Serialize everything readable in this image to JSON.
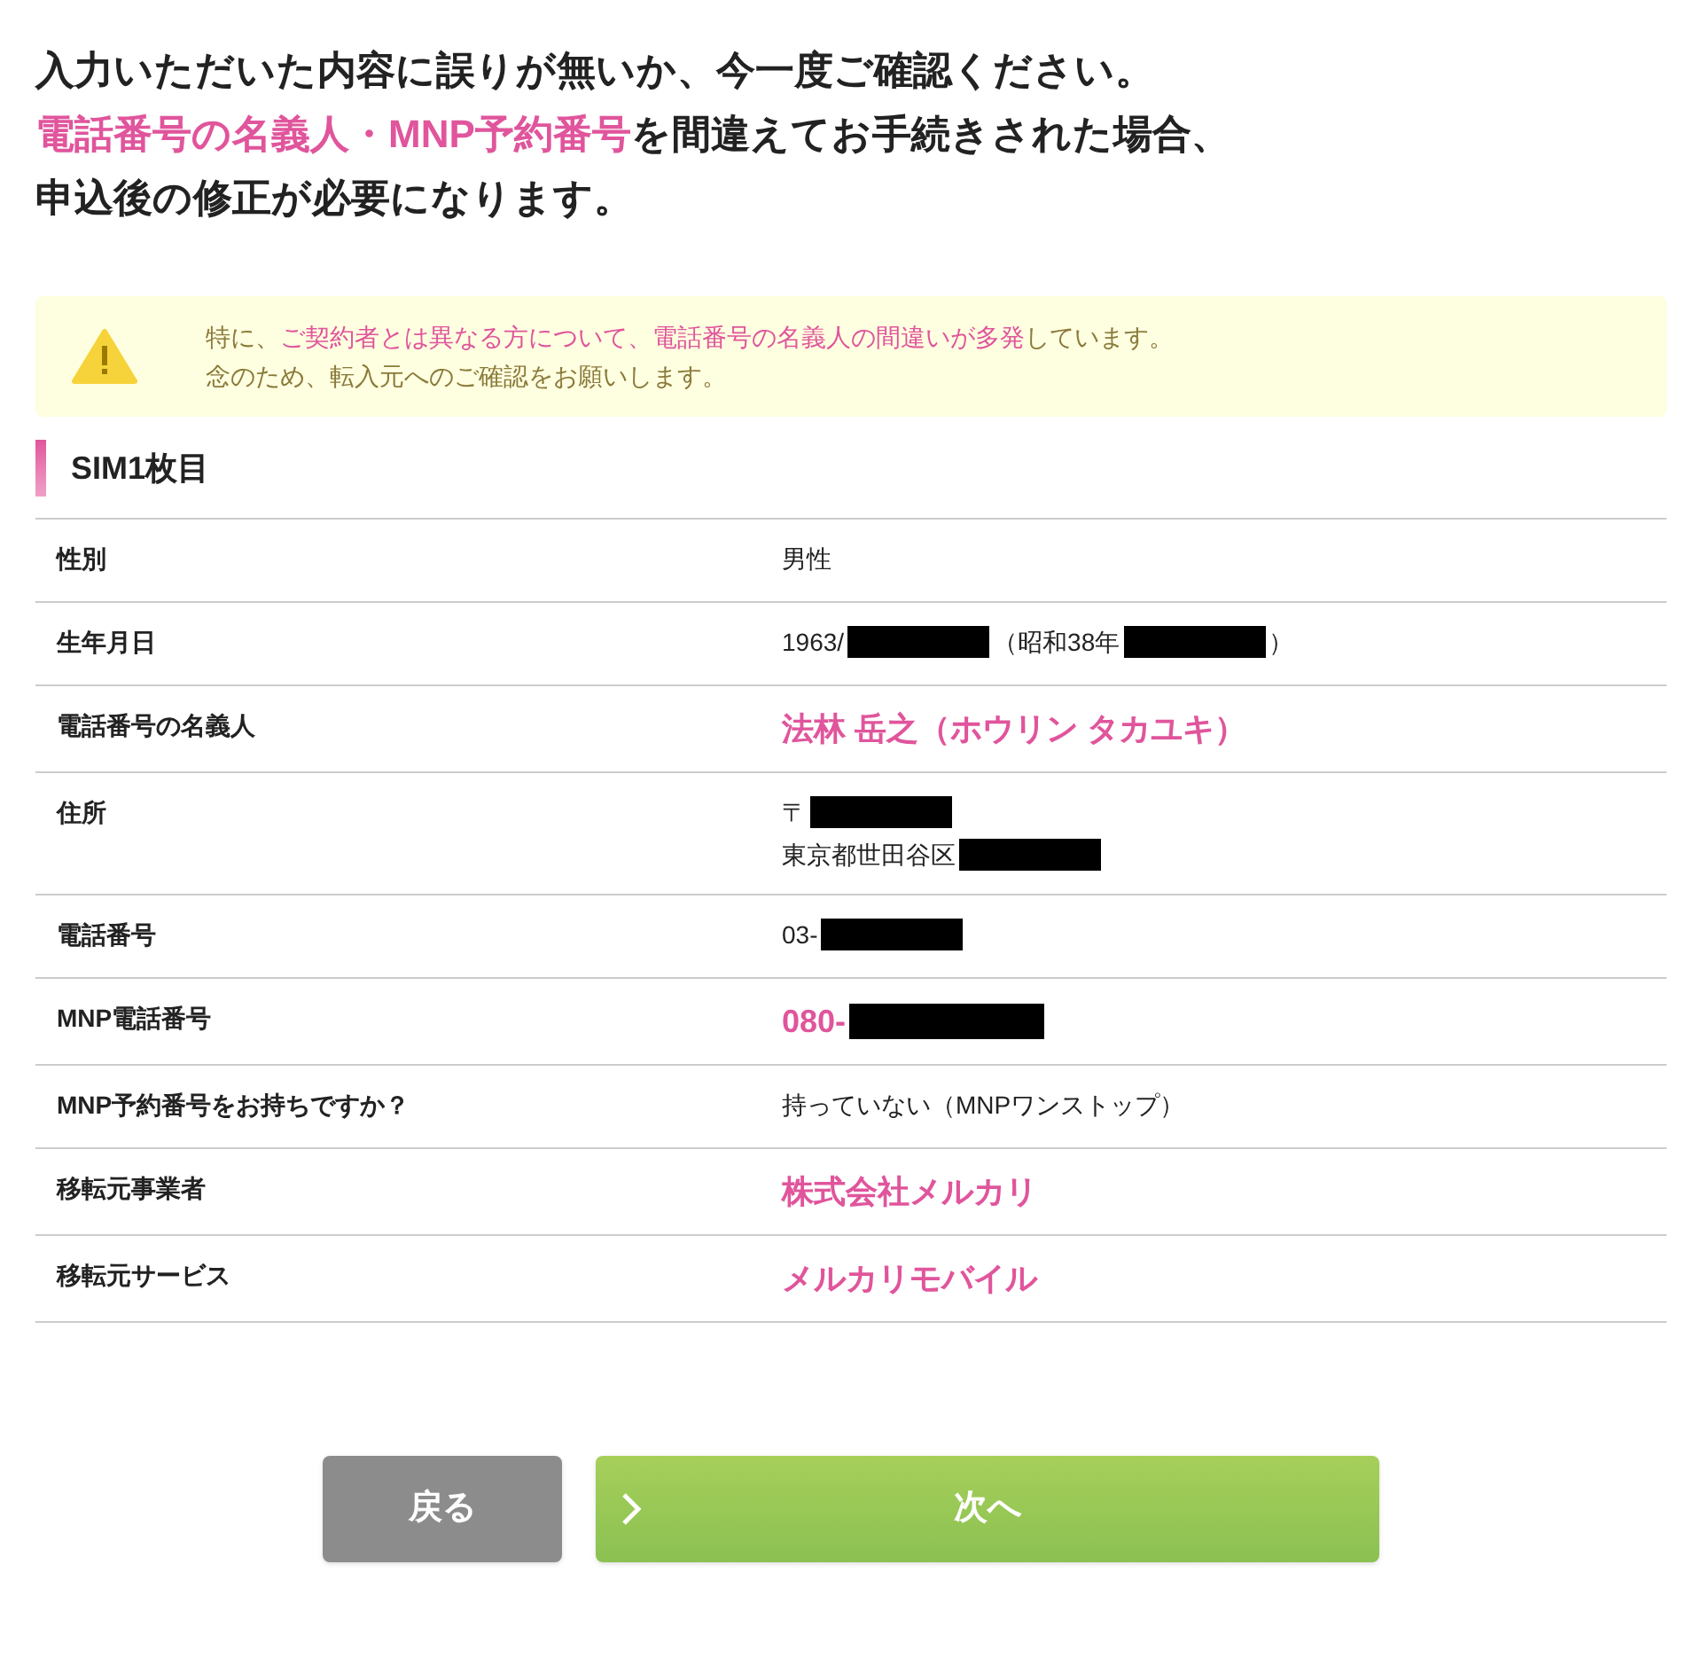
{
  "headline": [
    [
      {
        "text": "入力いただいた内容に誤りが無いか、今一度ご確認ください。",
        "highlight": false
      }
    ],
    [
      {
        "text": "電話番号の名義人・MNP予約番号",
        "highlight": true
      },
      {
        "text": "を間違えてお手続きされた場合、",
        "highlight": false
      }
    ],
    [
      {
        "text": "申込後の修正が必要になります。",
        "highlight": false
      }
    ]
  ],
  "notice": {
    "lines": [
      [
        {
          "text": "特に、",
          "highlight": false
        },
        {
          "text": "ご契約者とは異なる方について、電話番号の名義人の間違いが多発",
          "highlight": true
        },
        {
          "text": "しています。",
          "highlight": false
        }
      ],
      [
        {
          "text": "念のため、転入元へのご確認をお願いします。",
          "highlight": false
        }
      ]
    ]
  },
  "section_title": "SIM1枚目",
  "rows": [
    {
      "label": "性別",
      "emphasis": false,
      "lines": [
        [
          {
            "kind": "text",
            "text": "男性"
          }
        ]
      ]
    },
    {
      "label": "生年月日",
      "emphasis": false,
      "lines": [
        [
          {
            "kind": "text",
            "text": "1963/"
          },
          {
            "kind": "redacted"
          },
          {
            "kind": "text",
            "text": "（昭和38年"
          },
          {
            "kind": "redacted"
          },
          {
            "kind": "text",
            "text": "）"
          }
        ]
      ]
    },
    {
      "label": "電話番号の名義人",
      "emphasis": true,
      "lines": [
        [
          {
            "kind": "text",
            "text": "法林 岳之（ホウリン タカユキ）"
          }
        ]
      ]
    },
    {
      "label": "住所",
      "emphasis": false,
      "lines": [
        [
          {
            "kind": "text",
            "text": "〒"
          },
          {
            "kind": "redacted"
          }
        ],
        [
          {
            "kind": "text",
            "text": "東京都世田谷区"
          },
          {
            "kind": "redacted"
          }
        ]
      ]
    },
    {
      "label": "電話番号",
      "emphasis": false,
      "lines": [
        [
          {
            "kind": "text",
            "text": "03-"
          },
          {
            "kind": "redacted"
          }
        ]
      ]
    },
    {
      "label": "MNP電話番号",
      "emphasis": true,
      "lines": [
        [
          {
            "kind": "text",
            "text": "080-"
          },
          {
            "kind": "redacted"
          }
        ]
      ]
    },
    {
      "label": "MNP予約番号をお持ちですか？",
      "emphasis": false,
      "lines": [
        [
          {
            "kind": "text",
            "text": "持っていない（MNPワンストップ）"
          }
        ]
      ]
    },
    {
      "label": "移転元事業者",
      "emphasis": true,
      "lines": [
        [
          {
            "kind": "text",
            "text": "株式会社メルカリ"
          }
        ]
      ]
    },
    {
      "label": "移転元サービス",
      "emphasis": true,
      "lines": [
        [
          {
            "kind": "text",
            "text": "メルカリモバイル"
          }
        ]
      ]
    }
  ],
  "buttons": {
    "back": "戻る",
    "next": "次へ"
  }
}
